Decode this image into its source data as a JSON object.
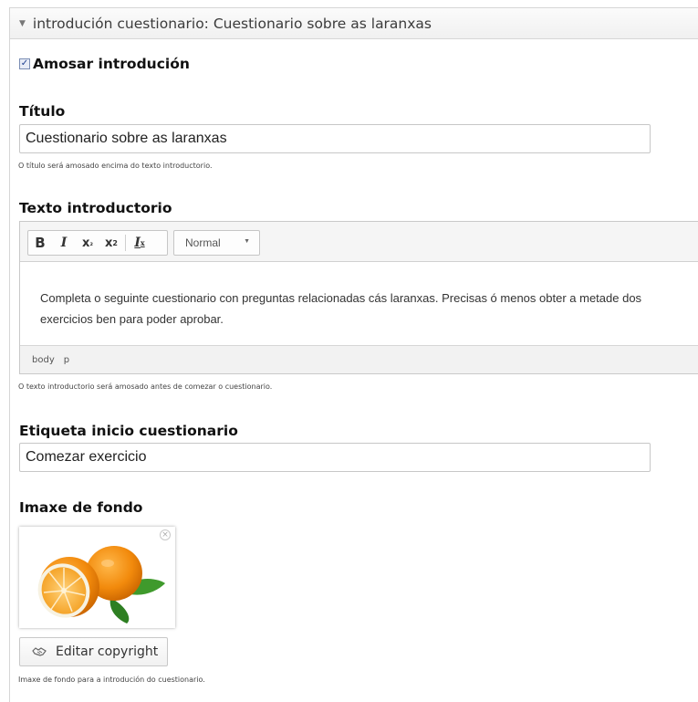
{
  "section": {
    "title": "introdución cuestionario: Cuestionario sobre as laranxas"
  },
  "show_intro": {
    "label": "Amosar introdución",
    "checked": true
  },
  "title_field": {
    "label": "Título",
    "value": "Cuestionario sobre as laranxas",
    "help": "O título será amosado encima do texto introductorio."
  },
  "intro_text": {
    "label": "Texto introductorio",
    "toolbar": {
      "bold": "B",
      "italic": "I",
      "subscript": "x",
      "superscript": "x",
      "remove_format": "I",
      "format_value": "Normal"
    },
    "content": "Completa o seguinte cuestionario con preguntas relacionadas cás laranxas. Precisas ó menos obter a metade dos exercicios ben para poder aprobar.",
    "path": [
      "body",
      "p"
    ],
    "help": "O texto introductorio será amosado antes de comezar o cuestionario."
  },
  "start_label": {
    "label": "Etiqueta inicio cuestionario",
    "value": "Comezar exercicio"
  },
  "background_image": {
    "label": "Imaxe de fondo",
    "remove_icon": "×",
    "edit_copyright_label": "Editar copyright",
    "help": "Imaxe de fondo para a introdución do cuestionario."
  },
  "colors": {
    "header_bg": "#f0f0f0",
    "orange": "#f28a0c",
    "leaf": "#2e8b2e"
  }
}
